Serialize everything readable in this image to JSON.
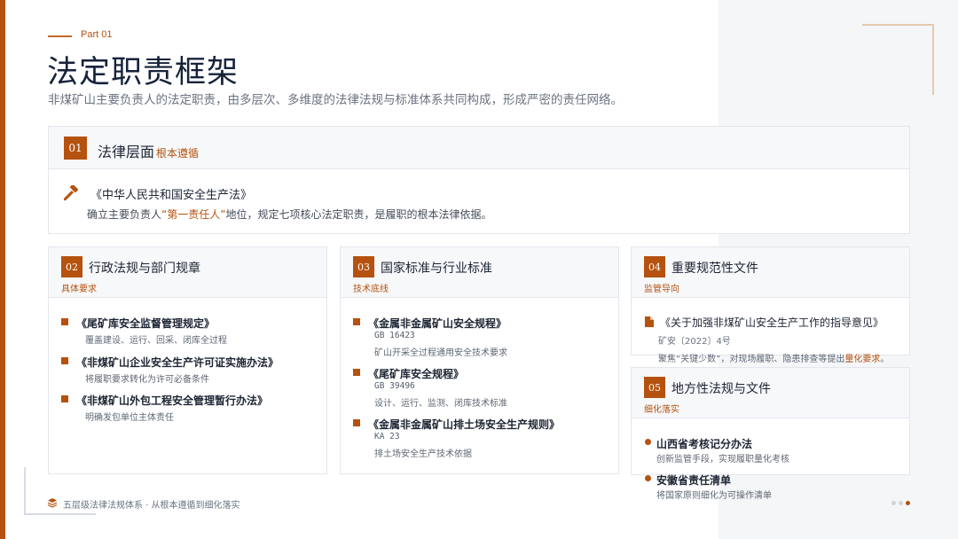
{
  "header": {
    "part_label": "Part 01",
    "title": "法定职责框架",
    "subtitle": "非煤矿山主要负责人的法定职责，由多层次、多维度的法律法规与标准体系共同构成，形成严密的责任网络。"
  },
  "law_layer": {
    "number": "01",
    "title": "法律层面",
    "tag": "根本遵循",
    "icon": "gavel-icon",
    "law_name": "《中华人民共和国安全生产法》",
    "desc_before": "确立主要负责人",
    "desc_highlight": "“第一责任人”",
    "desc_after": "地位，规定七项核心法定职责，是履职的根本法律依据。"
  },
  "admin_regs": {
    "number": "02",
    "title": "行政法规与部门规章",
    "tag": "具体要求",
    "items": [
      {
        "name": "《尾矿库安全监督管理规定》",
        "desc": "覆盖建设、运行、回采、闭库全过程"
      },
      {
        "name": "《非煤矿山企业安全生产许可证实施办法》",
        "desc": "将履职要求转化为许可必备条件"
      },
      {
        "name": "《非煤矿山外包工程安全管理暂行办法》",
        "desc": "明确发包单位主体责任"
      }
    ]
  },
  "standards": {
    "number": "03",
    "title": "国家标准与行业标准",
    "tag": "技术底线",
    "items": [
      {
        "name": "《金属非金属矿山安全规程》",
        "code": "GB 16423",
        "desc": "矿山开采全过程通用安全技术要求"
      },
      {
        "name": "《尾矿库安全规程》",
        "code": "GB 39496",
        "desc": "设计、运行、监测、闭库技术标准"
      },
      {
        "name": "《金属非金属矿山排土场安全生产规则》",
        "code": "KA 23",
        "desc": "排土场安全生产技术依据"
      }
    ]
  },
  "normative_docs": {
    "number": "04",
    "title": "重要规范性文件",
    "tag": "监管导向",
    "doc_title": "《关于加强非煤矿山安全生产工作的指导意见》",
    "doc_code": "矿安〔2022〕4号",
    "desc_before": "聚焦“关键少数”，对现场履职、隐患排查等提出",
    "desc_highlight": "量化要求",
    "desc_after": "。"
  },
  "local_regs": {
    "number": "05",
    "title": "地方性法规与文件",
    "tag": "细化落实",
    "items": [
      {
        "name": "山西省考核记分办法",
        "desc": "创新监管手段，实现履职量化考核"
      },
      {
        "name": "安徽省责任清单",
        "desc": "将国家原则细化为可操作清单"
      }
    ]
  },
  "footer": {
    "text": "五层级法律法规体系 · 从根本遵循到细化落实",
    "icon": "layers-icon"
  },
  "colors": {
    "accent": "#b5520f",
    "title": "#16233a",
    "panel": "#f4f6f8"
  }
}
